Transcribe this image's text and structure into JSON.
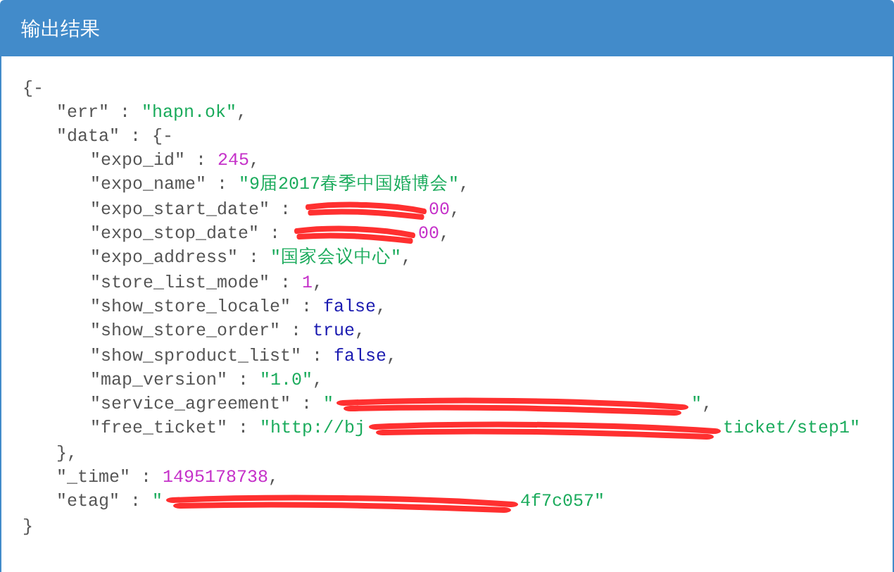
{
  "panel": {
    "title": "输出结果"
  },
  "root": {
    "open": "{",
    "toggle": "-",
    "close": "}",
    "entries": [
      {
        "key": "\"err\" :",
        "kind": "string",
        "value": "\"hapn.ok\"",
        "end": ","
      },
      {
        "key": "\"data\" :",
        "kind": "object",
        "open": "{",
        "toggle": "-",
        "close": "}",
        "end": ",",
        "children": [
          {
            "key": "\"expo_id\" :",
            "kind": "number",
            "value": "245",
            "end": ","
          },
          {
            "key": "\"expo_name\" :",
            "kind": "string",
            "value": "\"9届2017春季中国婚博会\"",
            "end": ","
          },
          {
            "key": "\"expo_start_date\" :",
            "kind": "redacted",
            "suffix": "00",
            "end": ","
          },
          {
            "key": "\"expo_stop_date\" :",
            "kind": "redacted",
            "suffix": "00",
            "end": ","
          },
          {
            "key": "\"expo_address\" :",
            "kind": "string",
            "value": "\"国家会议中心\"",
            "end": ","
          },
          {
            "key": "\"store_list_mode\" :",
            "kind": "number",
            "value": "1",
            "end": ","
          },
          {
            "key": "\"show_store_locale\" :",
            "kind": "boolean",
            "value": "false",
            "end": ","
          },
          {
            "key": "\"show_store_order\" :",
            "kind": "boolean",
            "value": "true",
            "end": ","
          },
          {
            "key": "\"show_sproduct_list\" :",
            "kind": "boolean",
            "value": "false",
            "end": ","
          },
          {
            "key": "\"map_version\" :",
            "kind": "string",
            "value": "\"1.0\"",
            "end": ","
          },
          {
            "key": "\"service_agreement\" :",
            "kind": "redacted",
            "prefix": "\"",
            "suffix": "\"",
            "end": ","
          },
          {
            "key": "\"free_ticket\" :",
            "kind": "redacted",
            "prefix": "\"http://bj",
            "suffix": "ticket/step1\""
          }
        ]
      },
      {
        "key": "\"_time\" :",
        "kind": "number",
        "value": "1495178738",
        "end": ","
      },
      {
        "key": "\"etag\" :",
        "kind": "redacted",
        "prefix": "\"",
        "suffix": "4f7c057\""
      }
    ]
  }
}
